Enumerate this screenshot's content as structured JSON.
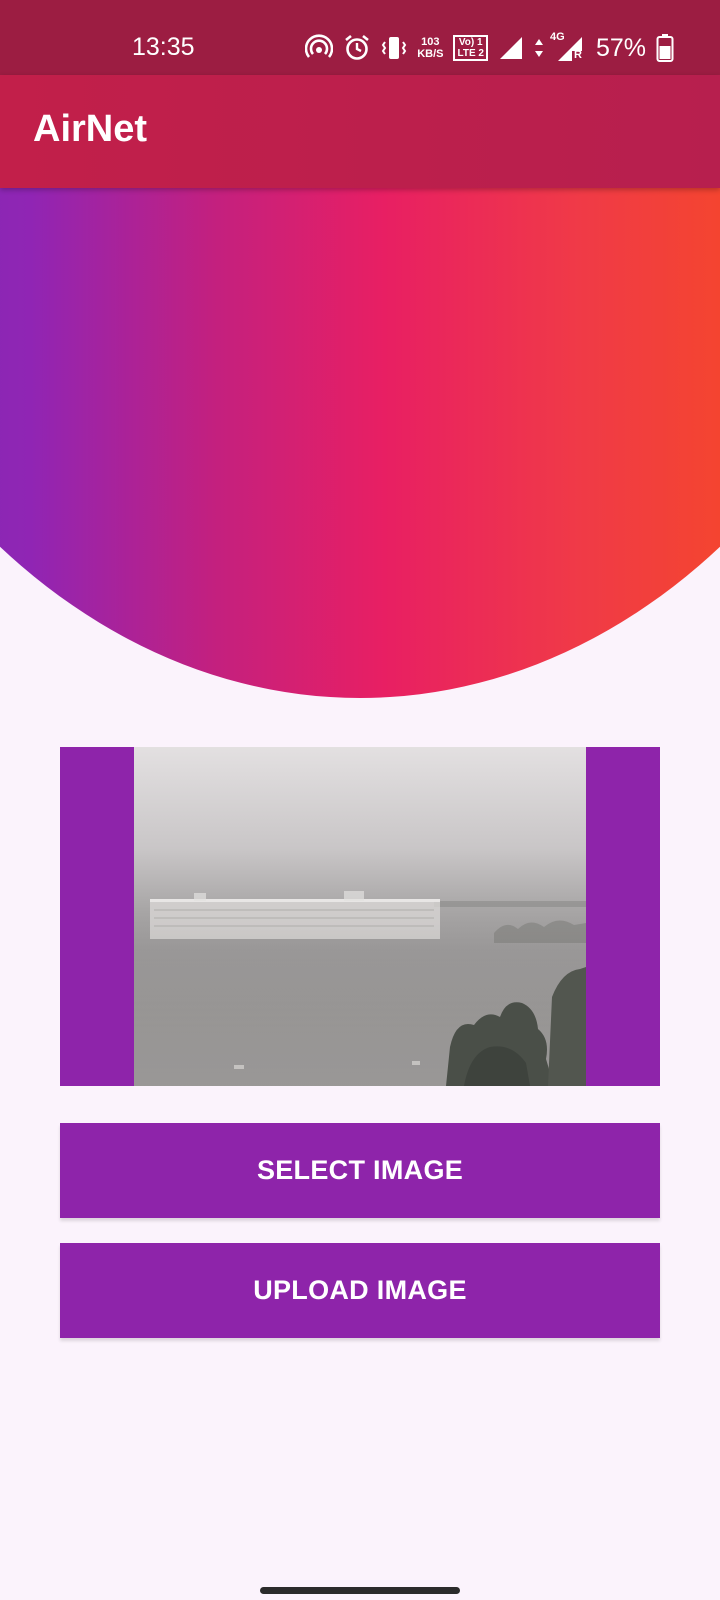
{
  "status_bar": {
    "time": "13:35",
    "net_speed_value": "103",
    "net_speed_unit": "KB/S",
    "volte_line1": "Vo) 1",
    "volte_line2": "LTE 2",
    "network_label": "4G",
    "roaming_label": "R",
    "battery_percent": "57%",
    "icons": [
      "hotspot-icon",
      "alarm-icon",
      "vibrate-icon",
      "signal-icon",
      "data-arrows-icon",
      "signal-4g-icon",
      "battery-icon"
    ]
  },
  "app_bar": {
    "title": "AirNet"
  },
  "buttons": {
    "select_label": "SELECT IMAGE",
    "upload_label": "UPLOAD IMAGE"
  },
  "colors": {
    "status_bar": "#9c1d42",
    "app_bar": "#c21f4a",
    "accent_purple": "#8e24aa",
    "background": "#fbf3fc",
    "gradient_start": "#7b35b8",
    "gradient_mid": "#e81f63",
    "gradient_end": "#f4452f"
  }
}
